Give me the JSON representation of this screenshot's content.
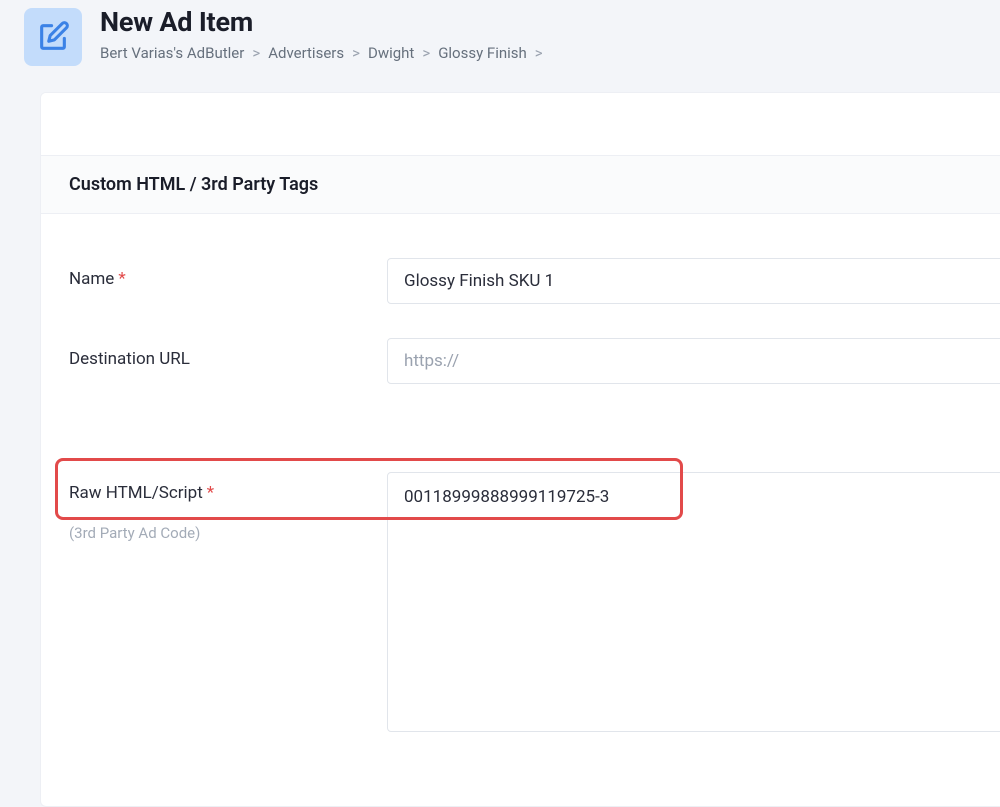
{
  "header": {
    "title": "New Ad Item",
    "breadcrumb": [
      "Bert Varias's AdButler",
      "Advertisers",
      "Dwight",
      "Glossy Finish"
    ]
  },
  "section": {
    "heading": "Custom HTML / 3rd Party Tags"
  },
  "form": {
    "name": {
      "label": "Name",
      "value": "Glossy Finish SKU 1"
    },
    "destination_url": {
      "label": "Destination URL",
      "placeholder": "https://",
      "value": ""
    },
    "raw_html": {
      "label": "Raw HTML/Script",
      "sublabel": "(3rd Party Ad Code)",
      "value": "00118999888999119725-3"
    }
  }
}
